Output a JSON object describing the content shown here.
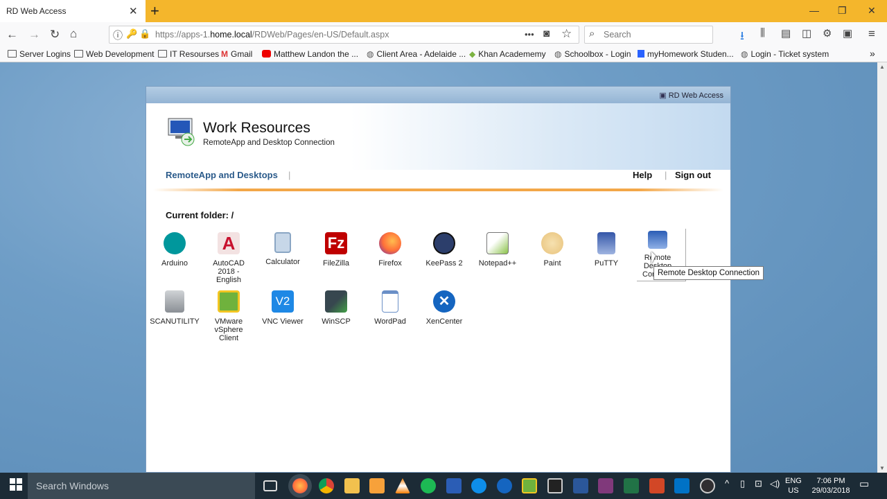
{
  "browser": {
    "tab_title": "RD Web Access",
    "tab_close": "✕",
    "new_tab": "+",
    "url_prefix": "https://apps-1.",
    "url_domain": "home.local",
    "url_path": "/RDWeb/Pages/en-US/Default.aspx",
    "search_placeholder": "Search",
    "page_actions": "•••",
    "bookmarks": [
      {
        "label": "Server Logins",
        "icon": "folder-icon"
      },
      {
        "label": "Web Development",
        "icon": "folder-icon"
      },
      {
        "label": "IT Resourses",
        "icon": "folder-icon"
      },
      {
        "label": "Gmail",
        "icon": "gmail-icon"
      },
      {
        "label": "Matthew Landon the ...",
        "icon": "youtube-icon"
      },
      {
        "label": "Client Area - Adelaide ...",
        "icon": "globe-icon"
      },
      {
        "label": "Khan Academemy",
        "icon": "leaf-icon"
      },
      {
        "label": "Schoolbox - Login",
        "icon": "globe-icon"
      },
      {
        "label": "myHomework Studen...",
        "icon": "bookmark-icon"
      },
      {
        "label": "Login - Ticket system",
        "icon": "globe-icon"
      }
    ],
    "bookmarks_overflow": "»"
  },
  "rdweb": {
    "header_label": "RD Web Access",
    "title": "Work Resources",
    "subtitle": "RemoteApp and Desktop Connection",
    "nav_main": "RemoteApp and Desktops",
    "separator": "|",
    "help": "Help",
    "sign_out": "Sign out",
    "current_folder": "Current folder: /",
    "apps_row1": [
      {
        "label": "Arduino",
        "color": "#00979c",
        "icon": "arduino-icon"
      },
      {
        "label": "AutoCAD 2018 - English",
        "color": "#c8102e",
        "icon": "autocad-icon"
      },
      {
        "label": "Calculator",
        "color": "#9fb9d6",
        "icon": "calculator-icon"
      },
      {
        "label": "FileZilla",
        "color": "#bf0000",
        "icon": "filezilla-icon"
      },
      {
        "label": "Firefox",
        "color": "#ff7139",
        "icon": "firefox-icon"
      },
      {
        "label": "KeePass 2",
        "color": "#2c3e6b",
        "icon": "keepass-icon"
      },
      {
        "label": "Notepad++",
        "color": "#8bc34a",
        "icon": "notepadpp-icon"
      },
      {
        "label": "Paint",
        "color": "#e8c27a",
        "icon": "paint-icon"
      },
      {
        "label": "PuTTY",
        "color": "#3456a8",
        "icon": "putty-icon"
      },
      {
        "label": "Remote Desktop Connection",
        "color": "#2b5db5",
        "icon": "remote-desktop-icon"
      }
    ],
    "apps_row2": [
      {
        "label": "SCANUTILITY",
        "color": "#8a8f95",
        "icon": "scanner-icon"
      },
      {
        "label": "VMware vSphere Client",
        "color": "#6fb23d",
        "icon": "vmware-icon"
      },
      {
        "label": "VNC Viewer",
        "color": "#1e88e5",
        "icon": "vnc-icon"
      },
      {
        "label": "WinSCP",
        "color": "#37474f",
        "icon": "winscp-icon"
      },
      {
        "label": "WordPad",
        "color": "#6a8fc7",
        "icon": "wordpad-icon"
      },
      {
        "label": "XenCenter",
        "color": "#1565c0",
        "icon": "xencenter-icon"
      }
    ],
    "tooltip": "Remote Desktop Connection"
  },
  "taskbar": {
    "search_placeholder": "Search Windows",
    "lang_top": "ENG",
    "lang_bottom": "US",
    "time": "7:06 PM",
    "date": "29/03/2018"
  }
}
